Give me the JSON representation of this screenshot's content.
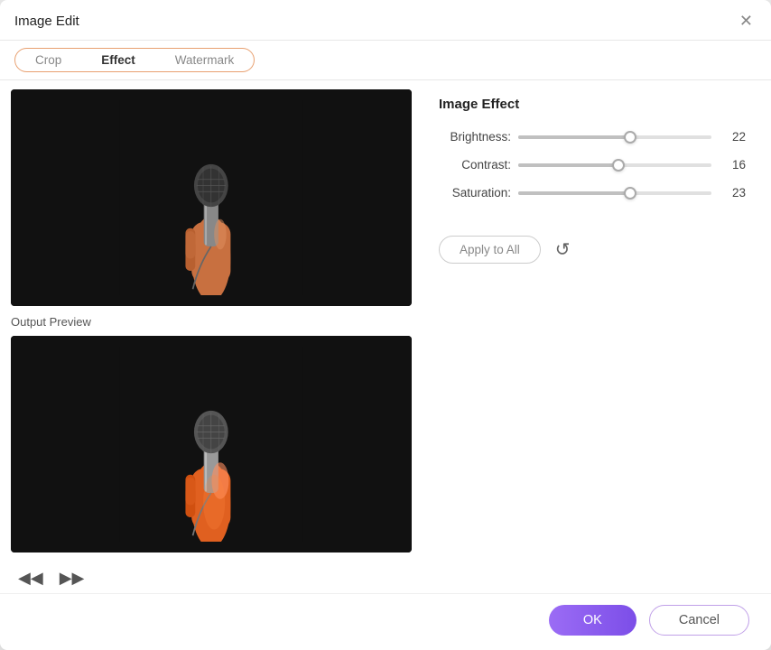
{
  "dialog": {
    "title": "Image Edit",
    "close_label": "✕"
  },
  "tabs": {
    "items": [
      {
        "label": "Crop",
        "active": false
      },
      {
        "label": "Effect",
        "active": true
      },
      {
        "label": "Watermark",
        "active": false
      }
    ]
  },
  "left": {
    "output_preview_label": "Output Preview"
  },
  "effect": {
    "title": "Image Effect",
    "sliders": [
      {
        "label": "Brightness:",
        "value": 22,
        "percent": 58
      },
      {
        "label": "Contrast:",
        "value": 16,
        "percent": 52
      },
      {
        "label": "Saturation:",
        "value": 23,
        "percent": 58
      }
    ],
    "apply_all_label": "Apply to All",
    "reset_icon": "↺"
  },
  "footer": {
    "ok_label": "OK",
    "cancel_label": "Cancel"
  }
}
